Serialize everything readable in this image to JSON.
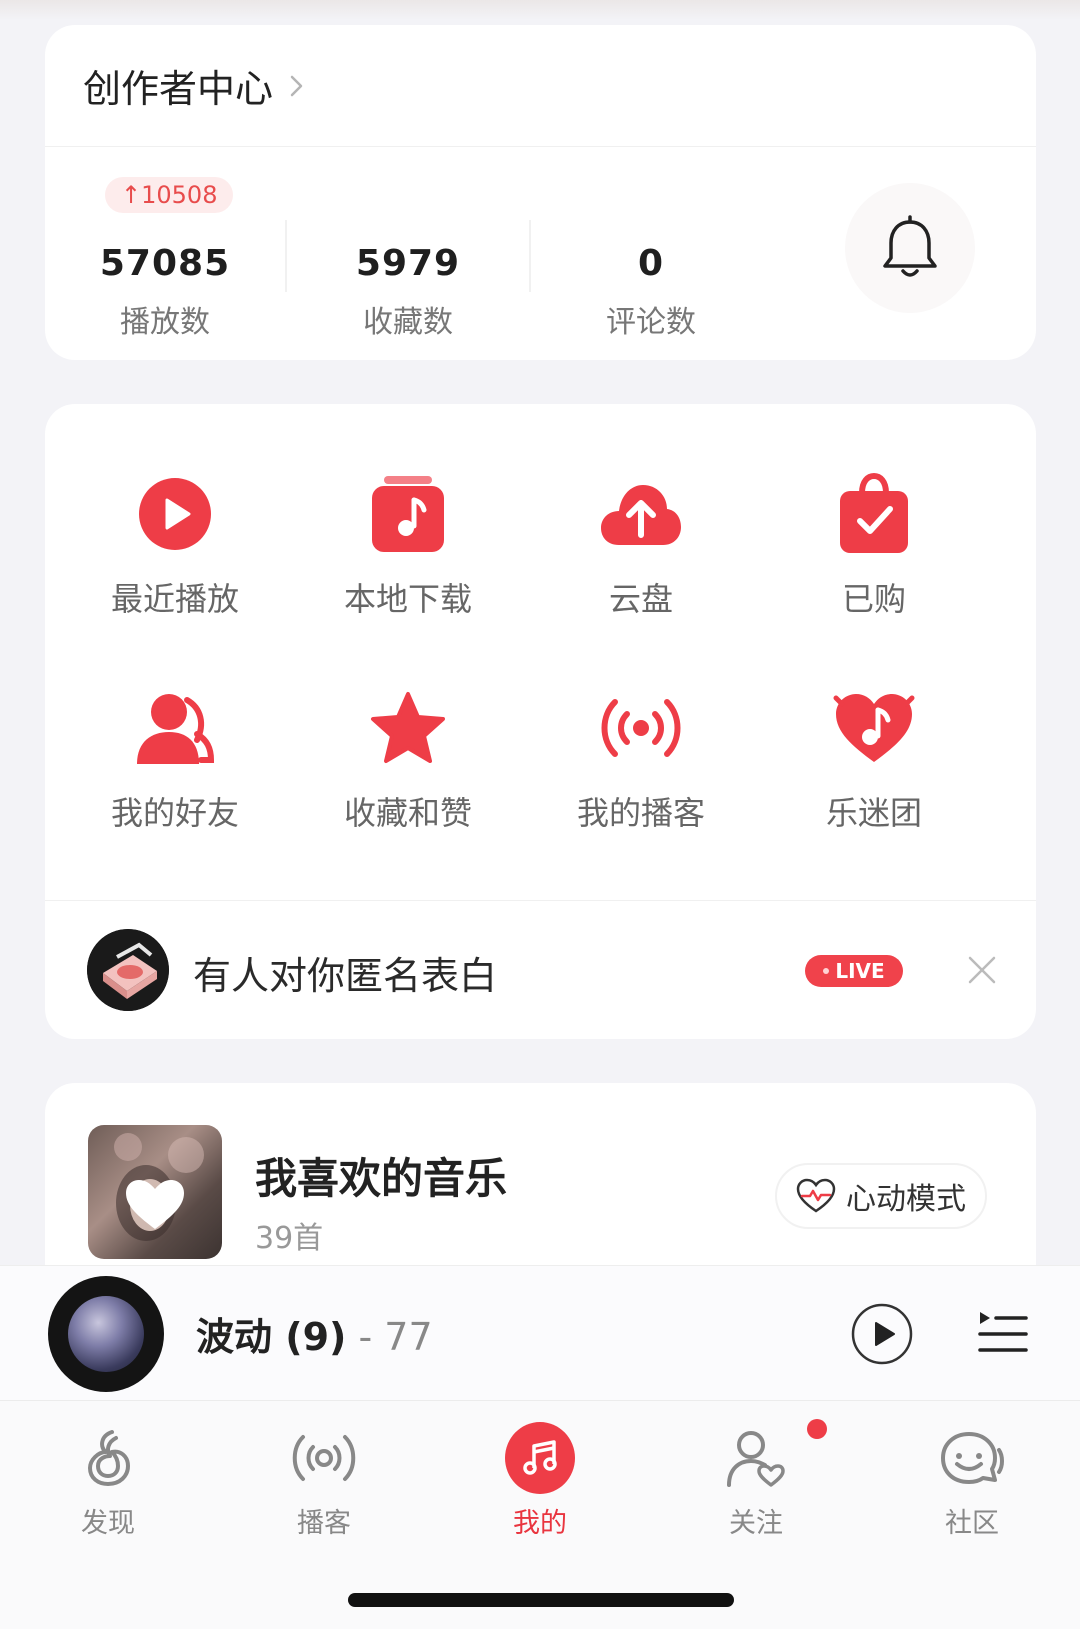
{
  "creator_center": {
    "title": "创作者中心",
    "stats": [
      {
        "value": "57085",
        "label": "播放数",
        "badge": "↑10508"
      },
      {
        "value": "5979",
        "label": "收藏数"
      },
      {
        "value": "0",
        "label": "评论数"
      }
    ],
    "bell_icon": "bell-icon"
  },
  "quick_grid": [
    {
      "label": "最近播放",
      "icon": "play-circle-icon"
    },
    {
      "label": "本地下载",
      "icon": "music-box-icon"
    },
    {
      "label": "云盘",
      "icon": "cloud-upload-icon"
    },
    {
      "label": "已购",
      "icon": "shopping-bag-icon"
    },
    {
      "label": "我的好友",
      "icon": "friends-icon"
    },
    {
      "label": "收藏和赞",
      "icon": "star-icon"
    },
    {
      "label": "我的播客",
      "icon": "podcast-icon"
    },
    {
      "label": "乐迷团",
      "icon": "heart-note-icon"
    }
  ],
  "promo": {
    "text": "有人对你匿名表白",
    "live_badge": "LIVE"
  },
  "liked_music": {
    "title": "我喜欢的音乐",
    "count": "39首",
    "heartbeat_button": "心动模式"
  },
  "now_playing": {
    "title": "波动 (9)",
    "artist": " - 77"
  },
  "tabs": [
    {
      "label": "发现",
      "icon": "discover-icon",
      "active": false
    },
    {
      "label": "播客",
      "icon": "podcast-tab-icon",
      "active": false
    },
    {
      "label": "我的",
      "icon": "music-note-icon",
      "active": true
    },
    {
      "label": "关注",
      "icon": "follow-icon",
      "active": false,
      "has_dot": true
    },
    {
      "label": "社区",
      "icon": "community-icon",
      "active": false
    }
  ],
  "colors": {
    "accent": "#ee3d47",
    "background": "#f3f3f7",
    "card": "#ffffff"
  }
}
